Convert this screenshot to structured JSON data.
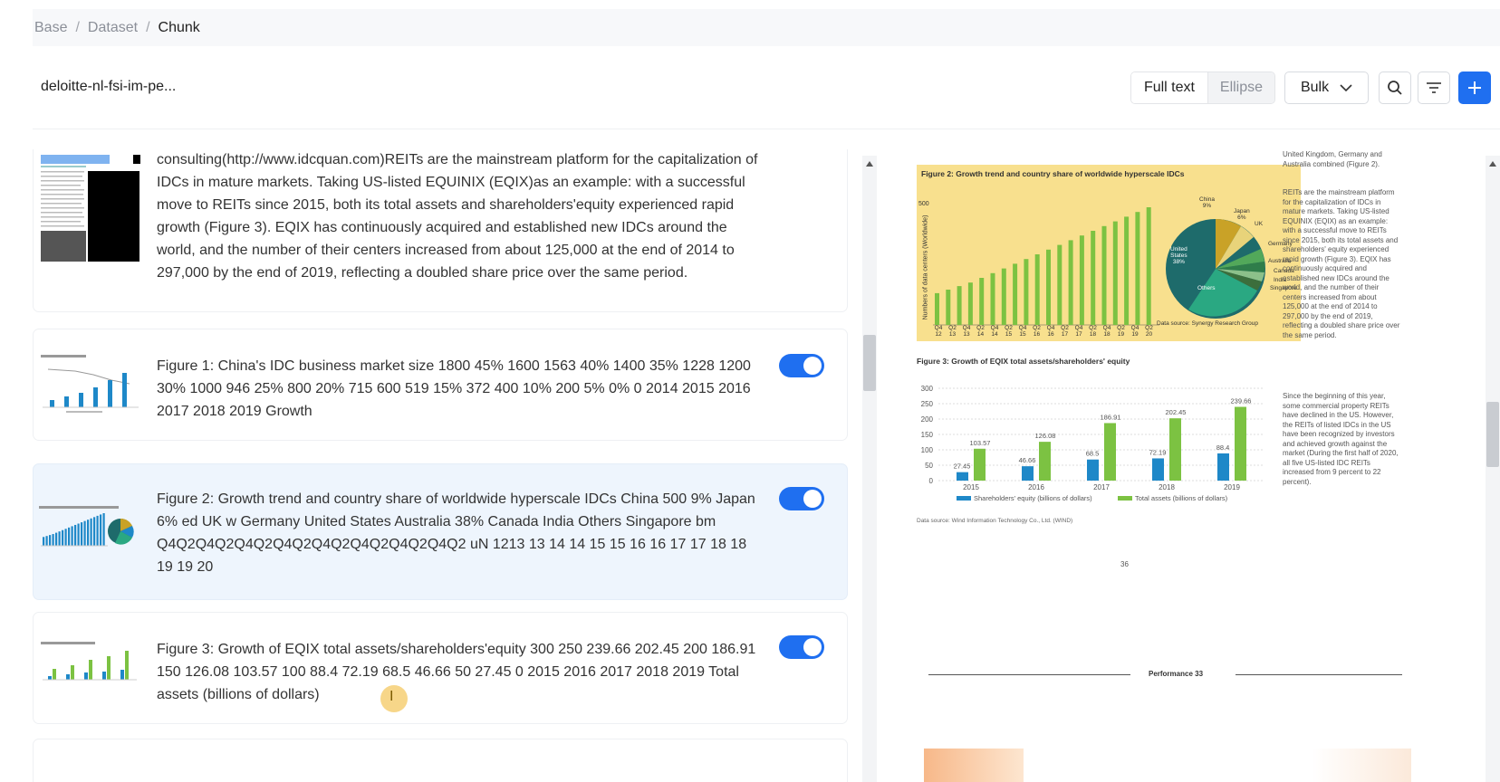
{
  "breadcrumb": {
    "items": [
      "Base",
      "Dataset",
      "Chunk"
    ]
  },
  "header": {
    "doc_title": "deloitte-nl-fsi-im-pe...",
    "view_toggle": {
      "full_text": "Full text",
      "ellipse": "Ellipse",
      "active": "Full text"
    },
    "bulk_label": "Bulk",
    "icons": [
      "search-icon",
      "filter-icon",
      "plus-icon"
    ]
  },
  "chunks": [
    {
      "text": "consulting(http://www.idcquan.com)REITs are the mainstream platform for the capitalization of IDCs in mature markets. Taking US-listed EQUINIX (EQIX)as an example: with a successful move to REITs since 2015, both its total assets and shareholders'equity experienced rapid growth (Figure 3). EQIX has continuously acquired and established new IDCs around the world, and the number of their centers increased from about 125,000 at the end of 2014 to 297,000 by the end of 2019, reflecting a doubled share price over the same period.",
      "enabled": null,
      "selected": false
    },
    {
      "text": "Figure 1: China's IDC business market size 1800 45% 1600 1563 40% 1400 35% 1228 1200 30% 1000 946 25% 800 20% 715 600 519 15% 372 400 10% 200 5% 0% 0 2014 2015 2016 2017 2018 2019 Growth",
      "enabled": true,
      "selected": false
    },
    {
      "text": "Figure 2: Growth trend and country share of worldwide hyperscale IDCs China 500 9% Japan 6% ed UK w Germany United States Australia 38% Canada India Others Singapore bm Q4Q2Q4Q2Q4Q2Q4Q2Q4Q2Q4Q2Q4Q2Q4Q2 uN 1213 13 14 14 15 15 16 16 17 17 18 18 19 19 20",
      "enabled": true,
      "selected": true
    },
    {
      "text": "Figure 3: Growth of EQIX total assets/shareholders'equity 300 250 239.66 202.45 200 186.91 150 126.08 103.57 100 88.4 72.19 68.5 46.66 50 27.45 0 2015 2016 2017 2018 2019 Total assets (billions of dollars)",
      "enabled": true,
      "selected": false
    }
  ],
  "cursor_glyph": "I",
  "pdf": {
    "fig2": {
      "title": "Figure 2: Growth trend and country share of worldwide hyperscale IDCs",
      "ylabel": "Numbers of data centers (Worldwide)",
      "ytop": "500",
      "quarters": [
        "Q4",
        "Q2",
        "Q4",
        "Q2",
        "Q4",
        "Q2",
        "Q4",
        "Q2",
        "Q4",
        "Q2",
        "Q4",
        "Q2",
        "Q4",
        "Q2",
        "Q4",
        "Q2"
      ],
      "years": [
        "12",
        "13",
        "13",
        "14",
        "14",
        "15",
        "15",
        "16",
        "16",
        "17",
        "17",
        "18",
        "18",
        "19",
        "19",
        "20"
      ],
      "bar_levels": [
        0.27,
        0.3,
        0.33,
        0.36,
        0.4,
        0.44,
        0.48,
        0.52,
        0.56,
        0.6,
        0.64,
        0.68,
        0.72,
        0.76,
        0.8,
        0.84,
        0.88,
        0.92,
        0.96,
        1.0
      ],
      "pie_labels": [
        {
          "name": "China",
          "pct": "9%"
        },
        {
          "name": "Japan",
          "pct": "6%"
        },
        {
          "name": "UK",
          "pct": ""
        },
        {
          "name": "Germany",
          "pct": ""
        },
        {
          "name": "Australia",
          "pct": ""
        },
        {
          "name": "Canada",
          "pct": ""
        },
        {
          "name": "India",
          "pct": ""
        },
        {
          "name": "Singapore",
          "pct": ""
        },
        {
          "name": "Others",
          "pct": ""
        },
        {
          "name": "United States",
          "pct": "38%"
        }
      ],
      "source": "Data source: Synergy Research Group"
    },
    "fig3": {
      "title": "Figure 3: Growth of EQIX total assets/shareholders' equity",
      "yticks": [
        "300",
        "250",
        "200",
        "150",
        "100",
        "50",
        "0"
      ],
      "years": [
        "2015",
        "2016",
        "2017",
        "2018",
        "2019"
      ],
      "equity": [
        27.45,
        46.66,
        68.5,
        72.19,
        88.4
      ],
      "assets": [
        103.57,
        126.08,
        186.91,
        202.45,
        239.66
      ],
      "legend_equity": "Shareholders' equity (billions of dollars)",
      "legend_assets": "Total assets (billions of dollars)",
      "source": "Data source: Wind Information Technology Co., Ltd. (WIND)"
    },
    "side_text_1": "United Kingdom, Germany and Australia combined (Figure 2).",
    "side_text_2": "REITs are the mainstream platform for the capitalization of IDCs in mature markets. Taking US-listed EQUINIX (EQIX) as an example: with a successful move to REITs since 2015, both its total assets and shareholders' equity experienced rapid growth (Figure 3). EQIX has continuously acquired and established new IDCs around the world, and the number of their centers increased from about 125,000 at the end of 2014 to 297,000 by the end of 2019, reflecting a doubled share price over the same period.",
    "side_text_3": "Since the beginning of this year, some commercial property REITs have declined in the US. However, the REITs of listed IDCs in the US have been recognized by investors and achieved growth against the market (During the first half of 2020, all five US-listed IDC REITs increased from 9 percent to 22 percent).",
    "page_number": "36",
    "footer_label": "Performance 33"
  },
  "colors": {
    "accent": "#1f6ff0",
    "selected_bg": "#eef5fd",
    "fig_bg": "#f8e08e",
    "green": "#7cc242",
    "blue": "#1e88c8",
    "teal": "#1e6b6b"
  }
}
